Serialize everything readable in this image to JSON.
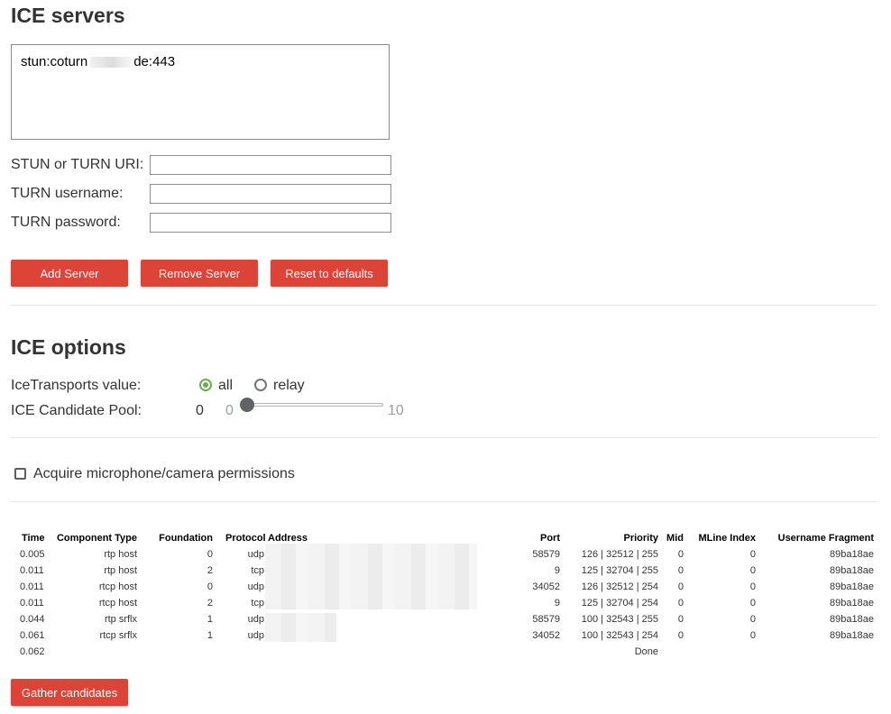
{
  "servers_section": {
    "title": "ICE servers",
    "server_list": {
      "prefix": "stun:coturn",
      "suffix": "de:443"
    },
    "uri_label": "STUN or TURN URI:",
    "username_label": "TURN username:",
    "password_label": "TURN password:",
    "uri_value": "",
    "username_value": "",
    "password_value": "",
    "buttons": {
      "add": "Add Server",
      "remove": "Remove Server",
      "reset": "Reset to defaults"
    }
  },
  "options_section": {
    "title": "ICE options",
    "transports_label": "IceTransports value:",
    "transport_options": [
      "all",
      "relay"
    ],
    "selected_transport": "all",
    "pool_label": "ICE Candidate Pool:",
    "pool_value": "0",
    "pool_min": "0",
    "pool_max": "10",
    "pool_fraction": 0
  },
  "permissions": {
    "label": "Acquire microphone/camera permissions",
    "checked": false
  },
  "candidates_table": {
    "headers": [
      "Time",
      "Component Type",
      "Foundation",
      "Protocol",
      "Address",
      "Port",
      "Priority",
      "Mid",
      "MLine Index",
      "Username Fragment"
    ],
    "rows": [
      [
        "0.005",
        "rtp host",
        "0",
        "udp",
        "",
        "58579",
        "126 | 32512 | 255",
        "0",
        "0",
        "89ba18ae"
      ],
      [
        "0.011",
        "rtp host",
        "2",
        "tcp",
        "",
        "9",
        "125 | 32704 | 255",
        "0",
        "0",
        "89ba18ae"
      ],
      [
        "0.011",
        "rtcp host",
        "0",
        "udp",
        "",
        "34052",
        "126 | 32512 | 254",
        "0",
        "0",
        "89ba18ae"
      ],
      [
        "0.011",
        "rtcp host",
        "2",
        "tcp",
        "",
        "9",
        "125 | 32704 | 254",
        "0",
        "0",
        "89ba18ae"
      ],
      [
        "0.044",
        "rtp srflx",
        "1",
        "udp",
        "",
        "58579",
        "100 | 32543 | 255",
        "0",
        "0",
        "89ba18ae"
      ],
      [
        "0.061",
        "rtcp srflx",
        "1",
        "udp",
        "",
        "34052",
        "100 | 32543 | 254",
        "0",
        "0",
        "89ba18ae"
      ]
    ],
    "final_row": {
      "time": "0.062",
      "priority": "Done"
    }
  },
  "gather_button": "Gather candidates",
  "colors": {
    "button_red": "#dc4437",
    "radio_green": "#6ab04c",
    "slider_thumb": "#5f6368"
  }
}
